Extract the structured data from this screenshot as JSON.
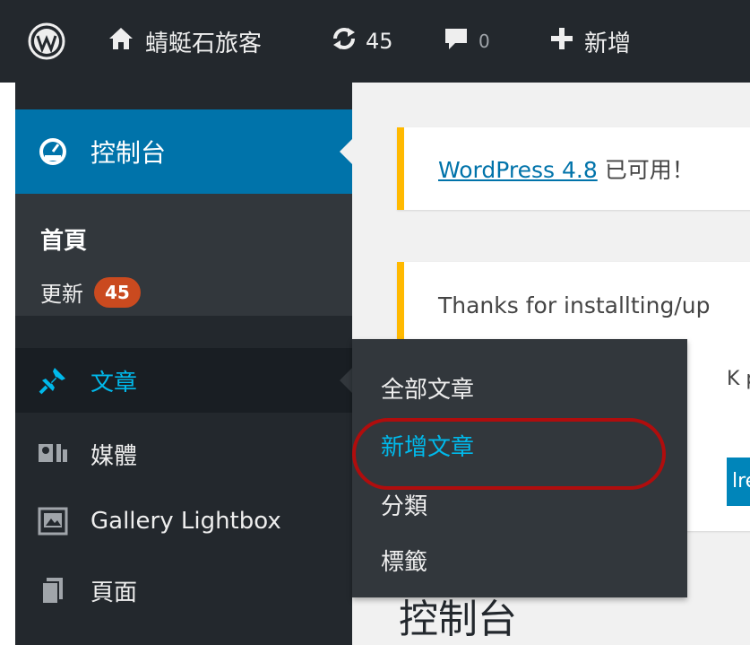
{
  "topbar": {
    "site_name": "蜻蜓石旅客",
    "updates_count": "45",
    "comments_count": "0",
    "new_label": "新增"
  },
  "notices": {
    "update_link": "WordPress 4.8",
    "update_text": " 已可用！",
    "thanks_text": "Thanks for installting/up",
    "partial_text": "K pe",
    "partial_button": "lreac"
  },
  "page_heading": "控制台",
  "sidebar": {
    "dashboard_label": "控制台",
    "home_label": "首頁",
    "updates_label": "更新",
    "updates_badge": "45",
    "posts_label": "文章",
    "media_label": "媒體",
    "gallery_label": "Gallery Lightbox",
    "pages_label": "頁面"
  },
  "flyout": {
    "all_posts": "全部文章",
    "add_new": "新增文章",
    "categories": "分類",
    "tags": "標籤"
  },
  "colors": {
    "admin_bar": "#23282d",
    "accent": "#0073aa",
    "active_link": "#00b9eb",
    "notice_warning": "#ffb900",
    "badge": "#ca4a1f",
    "highlight": "#b00d0d"
  }
}
